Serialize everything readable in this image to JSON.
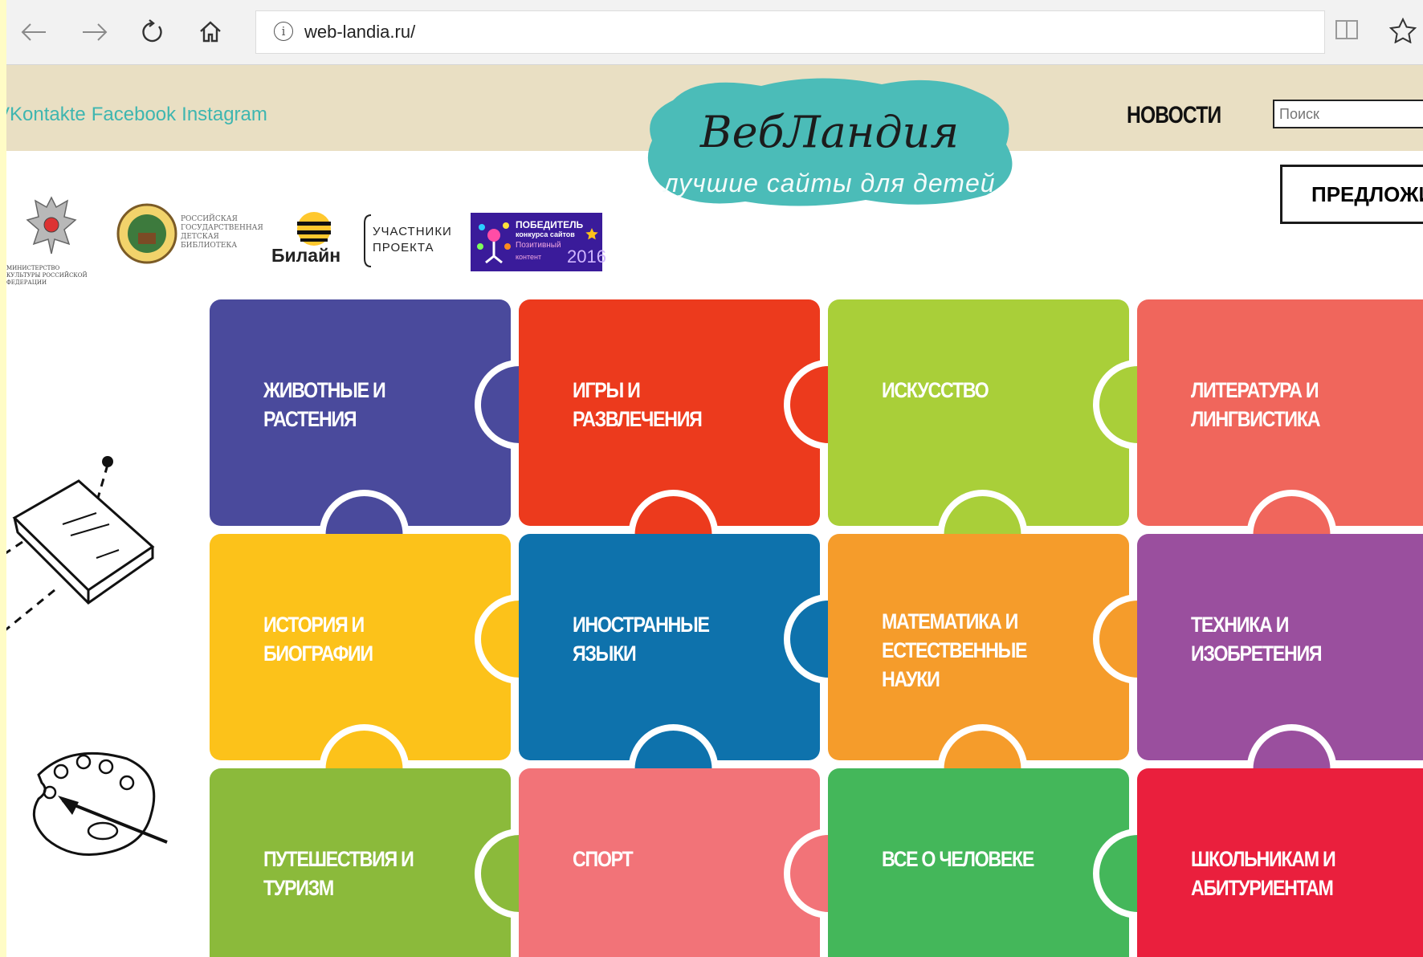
{
  "browser": {
    "back_icon": "back-arrow-icon",
    "forward_icon": "forward-arrow-icon",
    "refresh_icon": "refresh-icon",
    "home_icon": "home-icon",
    "info_symbol": "i",
    "url": "web-landia.ru/",
    "reading_icon": "reading-view-icon",
    "favorite_icon": "star-icon"
  },
  "header": {
    "social": [
      "VKontakte",
      "Facebook",
      "Instagram"
    ],
    "nav_news": "НОВОСТИ",
    "search_placeholder": "Поиск",
    "logo_title": "ВебЛандия",
    "logo_subtitle": "лучшие сайты для детей",
    "suggest_button": "ПРЕДЛОЖИТЬ",
    "colors": {
      "header_bg": "#e9dfc3",
      "social": "#3eb6b0",
      "logo_blob": "#4bbcb8"
    }
  },
  "partners": {
    "ministry": "МИНИСТЕРСТВО КУЛЬТУРЫ РОССИЙСКОЙ ФЕДЕРАЦИИ",
    "library": [
      "РОССИЙСКАЯ",
      "ГОСУДАРСТВЕННАЯ",
      "ДЕТСКАЯ",
      "БИБЛИОТЕКА"
    ],
    "beeline": "Билайн",
    "participants": [
      "УЧАСТНИКИ",
      "ПРОЕКТА"
    ],
    "winner": {
      "line1": "ПОБЕДИТЕЛЬ",
      "line2": "конкурса сайтов",
      "line3": "Позитивный",
      "line4": "контент",
      "year": "2016"
    }
  },
  "categories": [
    {
      "lines": [
        "ЖИВОТНЫЕ И",
        "РАСТЕНИЯ"
      ],
      "color": "#4a4a9c"
    },
    {
      "lines": [
        "ИГРЫ И",
        "РАЗВЛЕЧЕНИЯ"
      ],
      "color": "#ec3a1d"
    },
    {
      "lines": [
        "ИСКУССТВО"
      ],
      "color": "#a9cf39"
    },
    {
      "lines": [
        "ЛИТЕРАТУРА И",
        "ЛИНГВИСТИКА"
      ],
      "color": "#f0665c"
    },
    {
      "lines": [
        "ИСТОРИЯ И",
        "БИОГРАФИИ"
      ],
      "color": "#fcc21a"
    },
    {
      "lines": [
        "ИНОСТРАННЫЕ",
        "ЯЗЫКИ"
      ],
      "color": "#0e72ac"
    },
    {
      "lines": [
        "МАТЕМАТИКА И",
        "ЕСТЕСТВЕННЫЕ",
        "НАУКИ"
      ],
      "color": "#f59c2b"
    },
    {
      "lines": [
        "ТЕХНИКА И",
        "ИЗОБРЕТЕНИЯ"
      ],
      "color": "#9a4f9e"
    },
    {
      "lines": [
        "ПУТЕШЕСТВИЯ И",
        "ТУРИЗМ"
      ],
      "color": "#8bba3b"
    },
    {
      "lines": [
        "СПОРТ"
      ],
      "color": "#f27378"
    },
    {
      "lines": [
        "ВСЕ О ЧЕЛОВЕКЕ"
      ],
      "color": "#44b75a"
    },
    {
      "lines": [
        "ШКОЛЬНИКАМ И",
        "АБИТУРИЕНТАМ"
      ],
      "color": "#ea1f3d"
    }
  ]
}
